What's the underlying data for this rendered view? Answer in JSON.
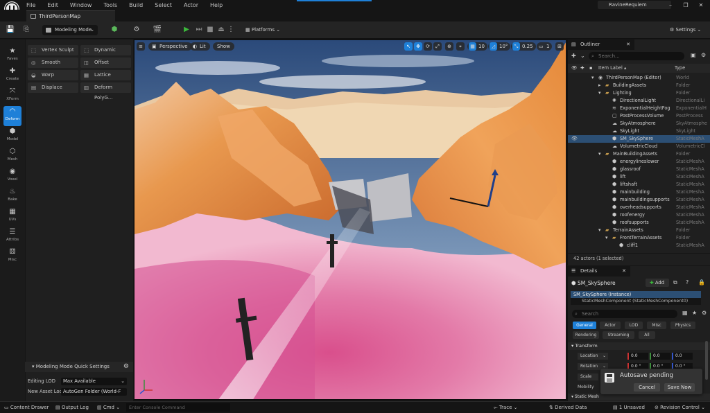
{
  "menu": [
    "File",
    "Edit",
    "Window",
    "Tools",
    "Build",
    "Select",
    "Actor",
    "Help"
  ],
  "project_name": "RavineRequiem",
  "window_controls": [
    "–",
    "❐",
    "✕"
  ],
  "doc_tab": "ThirdPersonMap",
  "toolbar": {
    "mode_label": "Modeling Mode",
    "platforms_label": "Platforms",
    "settings_label": "Settings"
  },
  "left_tools": [
    {
      "label": "Faves",
      "icon": "star-icon",
      "glyph": "★"
    },
    {
      "label": "Create",
      "icon": "create-icon",
      "glyph": "✚"
    },
    {
      "label": "XForm",
      "icon": "xform-icon",
      "glyph": "⤧"
    },
    {
      "label": "Deform",
      "icon": "deform-icon",
      "glyph": "◠"
    },
    {
      "label": "Model",
      "icon": "model-icon",
      "glyph": "⬢"
    },
    {
      "label": "Mesh",
      "icon": "mesh-icon",
      "glyph": "⬡"
    },
    {
      "label": "Voxel",
      "icon": "voxel-icon",
      "glyph": "◉"
    },
    {
      "label": "Bake",
      "icon": "bake-icon",
      "glyph": "♨"
    },
    {
      "label": "UVs",
      "icon": "uvs-icon",
      "glyph": "▦"
    },
    {
      "label": "Attribs",
      "icon": "attribs-icon",
      "glyph": "☰"
    },
    {
      "label": "Misc",
      "icon": "misc-icon",
      "glyph": "⚄"
    }
  ],
  "deform_tools": [
    {
      "label": "Vertex Sculpt",
      "glyph": "⬚"
    },
    {
      "label": "Dynamic Sculpt",
      "glyph": "⬚"
    },
    {
      "label": "Smooth",
      "glyph": "◎"
    },
    {
      "label": "Offset",
      "glyph": "◫"
    },
    {
      "label": "Warp",
      "glyph": "◒"
    },
    {
      "label": "Lattice",
      "glyph": "▦"
    },
    {
      "label": "Displace",
      "glyph": "▤"
    },
    {
      "label": "Deform PolyG...",
      "glyph": "▥"
    }
  ],
  "quick_settings": {
    "title": "Modeling Mode Quick Settings",
    "editing_lod_label": "Editing LOD",
    "editing_lod_value": "Max Available",
    "new_asset_label": "New Asset Loc",
    "new_asset_value": "AutoGen Folder (World-F"
  },
  "viewport": {
    "perspective": "Perspective",
    "lit": "Lit",
    "show": "Show",
    "grid_snap": "10",
    "rot_snap": "10°",
    "scale_snap": "0.25",
    "camera_speed": "1"
  },
  "outliner": {
    "title": "Outliner",
    "search_placeholder": "Search...",
    "col_label": "Item Label ▴",
    "col_type": "Type",
    "footer": "42 actors (1 selected)",
    "rows": [
      {
        "name": "ThirdPersonMap (Editor)",
        "type": "World",
        "indent": 0,
        "kind": "world"
      },
      {
        "name": "BuildingAssets",
        "type": "Folder",
        "indent": 1,
        "kind": "folder"
      },
      {
        "name": "Lighting",
        "type": "Folder",
        "indent": 1,
        "kind": "folder"
      },
      {
        "name": "DirectionalLight",
        "type": "DirectionalLi",
        "indent": 2,
        "kind": "light"
      },
      {
        "name": "ExponentialHeightFog",
        "type": "ExponentialH",
        "indent": 2,
        "kind": "fog"
      },
      {
        "name": "PostProcessVolume",
        "type": "PostProcess",
        "indent": 2,
        "kind": "volume"
      },
      {
        "name": "SkyAtmosphere",
        "type": "SkyAtmosphe",
        "indent": 2,
        "kind": "sky"
      },
      {
        "name": "SkyLight",
        "type": "SkyLight",
        "indent": 2,
        "kind": "sky"
      },
      {
        "name": "SM_SkySphere",
        "type": "StaticMeshA",
        "indent": 2,
        "kind": "mesh",
        "selected": true
      },
      {
        "name": "VolumetricCloud",
        "type": "VolumetricCl",
        "indent": 2,
        "kind": "cloud"
      },
      {
        "name": "MainBuildingAssets",
        "type": "Folder",
        "indent": 1,
        "kind": "folder"
      },
      {
        "name": "energylineslower",
        "type": "StaticMeshA",
        "indent": 2,
        "kind": "mesh"
      },
      {
        "name": "glassroof",
        "type": "StaticMeshA",
        "indent": 2,
        "kind": "mesh"
      },
      {
        "name": "lift",
        "type": "StaticMeshA",
        "indent": 2,
        "kind": "mesh"
      },
      {
        "name": "liftshaft",
        "type": "StaticMeshA",
        "indent": 2,
        "kind": "mesh"
      },
      {
        "name": "mainbuilding",
        "type": "StaticMeshA",
        "indent": 2,
        "kind": "mesh"
      },
      {
        "name": "mainbuildingsupports",
        "type": "StaticMeshA",
        "indent": 2,
        "kind": "mesh"
      },
      {
        "name": "overheadsupports",
        "type": "StaticMeshA",
        "indent": 2,
        "kind": "mesh"
      },
      {
        "name": "roofenergy",
        "type": "StaticMeshA",
        "indent": 2,
        "kind": "mesh"
      },
      {
        "name": "roofsupports",
        "type": "StaticMeshA",
        "indent": 2,
        "kind": "mesh"
      },
      {
        "name": "TerrainAssets",
        "type": "Folder",
        "indent": 1,
        "kind": "folder"
      },
      {
        "name": "FrontTerrainAssets",
        "type": "Folder",
        "indent": 2,
        "kind": "folder"
      },
      {
        "name": "cliff1",
        "type": "StaticMeshA",
        "indent": 3,
        "kind": "mesh"
      }
    ]
  },
  "details": {
    "title": "Details",
    "actor_name": "SM_SkySphere",
    "add_label": "Add",
    "instance_label": "SM_SkySphere (Instance)",
    "component_label": "StaticMeshComponent (StaticMeshComponent0)",
    "search_placeholder": "Search",
    "categories": [
      "General",
      "Actor",
      "LOD",
      "Misc",
      "Physics",
      "Rendering",
      "Streaming",
      "All"
    ],
    "section_transform": "Transform",
    "location_label": "Location",
    "rotation_label": "Rotation",
    "scale_label": "Scale",
    "mobility_label": "Mobility",
    "location_values": [
      "0.0",
      "0.0",
      "0.0"
    ],
    "rotation_values": [
      "0.0 °",
      "0.0 °",
      "0.0 °"
    ],
    "section_static_mesh": "Static Mesh"
  },
  "toast": {
    "title": "Autosave pending",
    "cancel": "Cancel",
    "save_now": "Save Now"
  },
  "statusbar": {
    "content_drawer": "Content Drawer",
    "output_log": "Output Log",
    "cmd": "Cmd",
    "console_placeholder": "Enter Console Command",
    "trace": "Trace",
    "derived_data": "Derived Data",
    "unsaved": "1 Unsaved",
    "revision_control": "Revision Control"
  },
  "colors": {
    "accent": "#1e80d8",
    "selection": "#2c4f74",
    "play_green": "#3cba3c",
    "folder": "#c49a4c"
  }
}
